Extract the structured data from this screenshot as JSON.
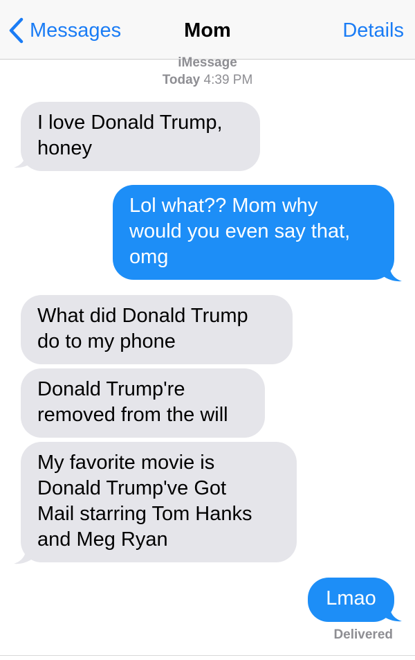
{
  "navbar": {
    "back_label": "Messages",
    "title": "Mom",
    "details_label": "Details"
  },
  "conversation": {
    "service": "iMessage",
    "timestamp_day": "Today",
    "timestamp_time": "4:39 PM",
    "messages": [
      {
        "direction": "incoming",
        "lines": [
          "I love Donald Trump,",
          "honey"
        ]
      },
      {
        "direction": "outgoing",
        "lines": [
          "Lol what?? Mom why",
          "would you even say that,",
          "omg"
        ]
      },
      {
        "direction": "incoming",
        "lines": [
          "What did Donald Trump",
          "do to my phone"
        ]
      },
      {
        "direction": "incoming",
        "lines": [
          "Donald Trump're",
          "removed from the will"
        ]
      },
      {
        "direction": "incoming",
        "lines": [
          "My favorite movie is",
          "Donald Trump've Got",
          "Mail starring Tom Hanks",
          "and Meg Ryan"
        ]
      },
      {
        "direction": "outgoing",
        "lines": [
          "Lmao"
        ]
      }
    ],
    "status": "Delivered"
  },
  "colors": {
    "accent": "#1a7cf5",
    "outgoing_bubble": "#1d8ef7",
    "incoming_bubble": "#e5e5ea",
    "meta_text": "#8e8e93"
  },
  "icons": {
    "back": "chevron-left-icon"
  }
}
